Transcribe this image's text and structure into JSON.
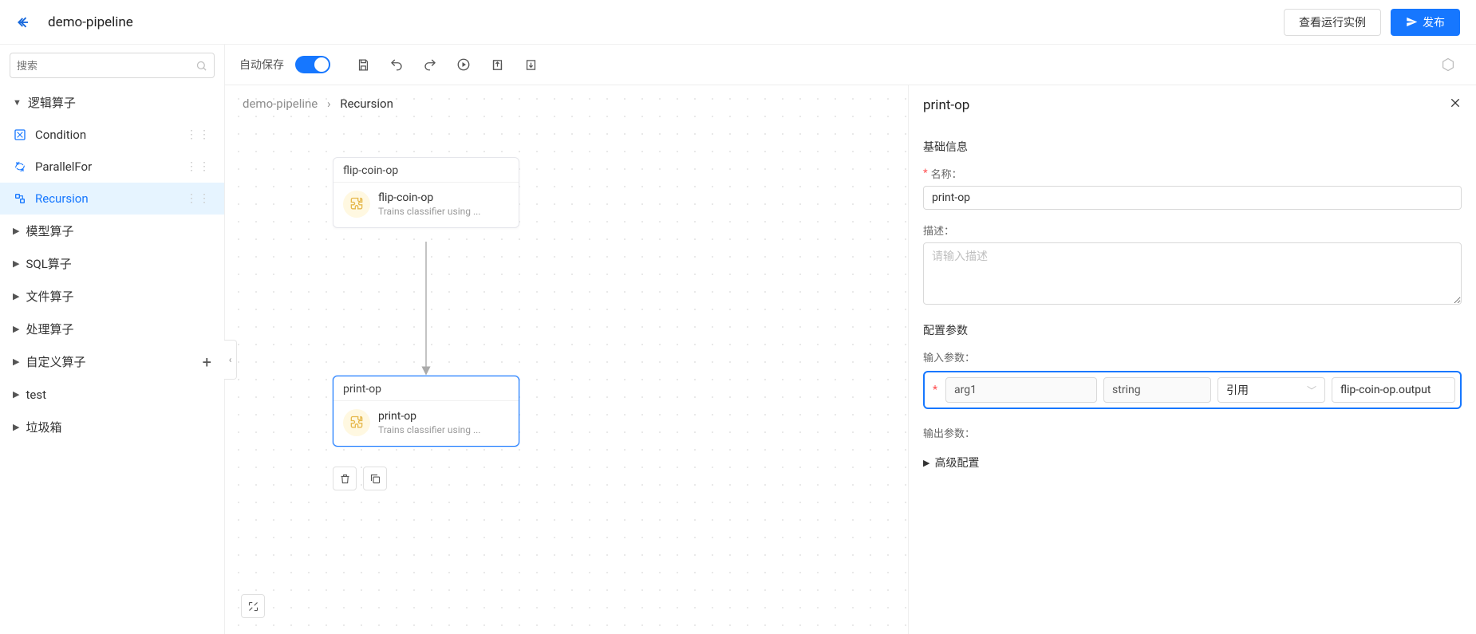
{
  "header": {
    "title": "demo-pipeline",
    "view_instances": "查看运行实例",
    "publish": "发布"
  },
  "sidebar": {
    "search_placeholder": "搜索",
    "groups": [
      {
        "label": "逻辑算子",
        "expanded": true,
        "items": [
          {
            "icon": "condition-icon",
            "label": "Condition"
          },
          {
            "icon": "parallelfor-icon",
            "label": "ParallelFor"
          },
          {
            "icon": "recursion-icon",
            "label": "Recursion",
            "active": true
          }
        ]
      },
      {
        "label": "模型算子"
      },
      {
        "label": "SQL算子"
      },
      {
        "label": "文件算子"
      },
      {
        "label": "处理算子"
      },
      {
        "label": "自定义算子",
        "has_plus": true
      },
      {
        "label": "test"
      },
      {
        "label": "垃圾箱"
      }
    ]
  },
  "toolbar": {
    "autosave_label": "自动保存",
    "autosave_on": true
  },
  "breadcrumb": {
    "root": "demo-pipeline",
    "current": "Recursion"
  },
  "nodes": {
    "flip": {
      "title": "flip-coin-op",
      "name": "flip-coin-op",
      "sub": "Trains classifier using ..."
    },
    "print": {
      "title": "print-op",
      "name": "print-op",
      "sub": "Trains classifier using ..."
    }
  },
  "panel": {
    "title": "print-op",
    "section_basic": "基础信息",
    "name_label": "名称：",
    "name_value": "print-op",
    "desc_label": "描述：",
    "desc_placeholder": "请输入描述",
    "section_params": "配置参数",
    "input_params_label": "输入参数：",
    "row": {
      "name": "arg1",
      "type": "string",
      "mode": "引用",
      "value": "flip-coin-op.output"
    },
    "output_params_label": "输出参数：",
    "advanced": "高级配置"
  }
}
